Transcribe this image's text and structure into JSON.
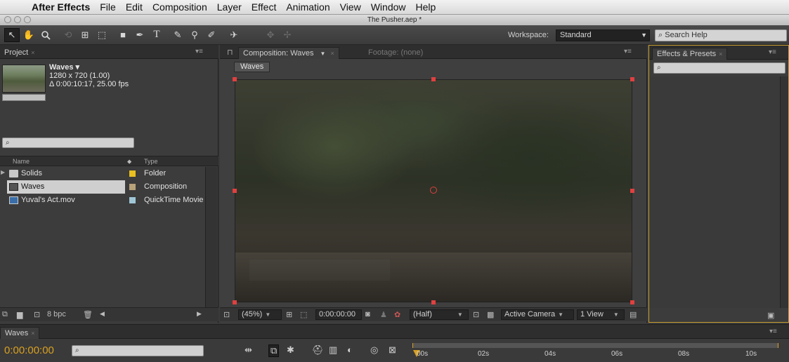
{
  "menubar": {
    "app": "After Effects",
    "items": [
      "File",
      "Edit",
      "Composition",
      "Layer",
      "Effect",
      "Animation",
      "View",
      "Window",
      "Help"
    ]
  },
  "window": {
    "title": "The Pusher.aep *"
  },
  "toolbar": {
    "workspace_label": "Workspace:",
    "workspace_value": "Standard",
    "search_help_placeholder": "Search Help",
    "tool_glyphs": [
      "↖",
      "✋",
      "🔍",
      "⟲",
      "⊞",
      "⬚",
      "■",
      "✒",
      "T",
      "✎",
      "⚲",
      "✐",
      "✈",
      "✥",
      "✢"
    ]
  },
  "project": {
    "tab": "Project",
    "selected_name": "Waves ▾",
    "selected_size": "1280 x 720 (1.00)",
    "selected_duration": "Δ 0:00:10:17, 25.00 fps",
    "columns": {
      "name": "Name",
      "type": "Type"
    },
    "items": [
      {
        "name": "Solids",
        "type": "Folder",
        "color": "#e8c020",
        "icon": "folder-icon"
      },
      {
        "name": "Waves",
        "type": "Composition",
        "color": "#b8a27a",
        "icon": "composition-icon",
        "selected": true
      },
      {
        "name": "Yuval's Act.mov",
        "type": "QuickTime Movie",
        "color": "#9fc6d6",
        "icon": "movie-icon"
      }
    ],
    "bpc": "8 bpc"
  },
  "composition": {
    "tab": "Composition: Waves",
    "footage_tab": "Footage: (none)",
    "breadcrumb": "Waves",
    "zoom": "(45%)",
    "timecode": "0:00:00:00",
    "resolution": "(Half)",
    "camera": "Active Camera",
    "views": "1 View"
  },
  "effects": {
    "tab": "Effects & Presets"
  },
  "timeline": {
    "tab": "Waves",
    "timecode": "0:00:00:00",
    "ruler": [
      "00s",
      "02s",
      "04s",
      "06s",
      "08s",
      "10s"
    ]
  }
}
